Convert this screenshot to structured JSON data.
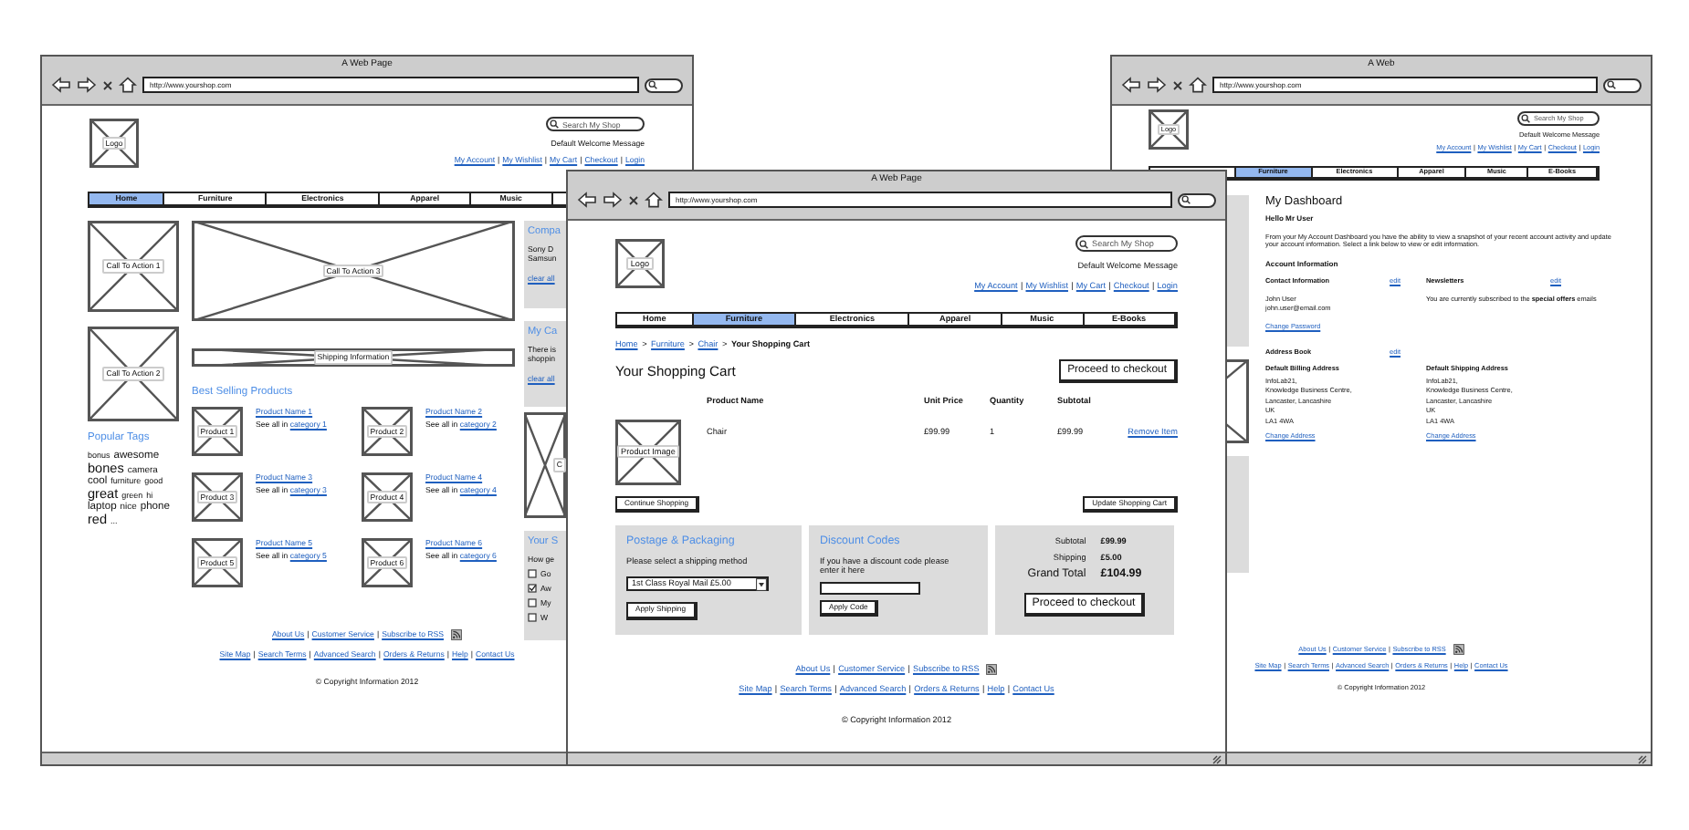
{
  "windows": [
    {
      "kind": "home",
      "title": "A Web Page",
      "url": "http://www.yourshop.com",
      "header": {
        "logo": "Logo",
        "search_placeholder": "Search My Shop",
        "welcome": "Default Welcome Message",
        "links": [
          "My Account",
          "My Wishlist",
          "My Cart",
          "Checkout",
          "Login"
        ],
        "separator": "|"
      },
      "nav": [
        {
          "label": "Home",
          "selected": true
        },
        {
          "label": "Furniture",
          "selected": false
        },
        {
          "label": "Electronics",
          "selected": false
        },
        {
          "label": "Apparel",
          "selected": false
        },
        {
          "label": "Music",
          "selected": false
        },
        {
          "selected": false
        }
      ],
      "ctas": [
        "Call To Action 1",
        "Call To Action 2"
      ],
      "banner": "Call To Action 3",
      "shipping_banner": "Shipping Information",
      "popular_tags": {
        "title": "Popular Tags",
        "tags": [
          {
            "label": "bonus",
            "kind": "tiny"
          },
          {
            "label": "awesome",
            "kind": "medium"
          },
          {
            "label": "bones",
            "kind": "large"
          },
          {
            "label": "camera",
            "kind": "small"
          },
          {
            "label": "cool",
            "kind": "medium"
          },
          {
            "label": "furniture",
            "kind": "tiny"
          },
          {
            "label": "good",
            "kind": "tiny"
          },
          {
            "label": "great",
            "kind": "large"
          },
          {
            "label": "green",
            "kind": "tiny"
          },
          {
            "label": "hi",
            "kind": "tiny"
          },
          {
            "label": "laptop",
            "kind": "medium"
          },
          {
            "label": "nice",
            "kind": "small"
          },
          {
            "label": "phone",
            "kind": "medium"
          },
          {
            "label": "red",
            "kind": "large"
          },
          {
            "label": "...",
            "kind": "tiny"
          }
        ]
      },
      "best_selling": {
        "title": "Best Selling Products",
        "products": [
          {
            "image": "Product 1",
            "name": "Product Name 1",
            "see_all": "See all in",
            "category": "category 1"
          },
          {
            "image": "Product 2",
            "name": "Product Name 2",
            "see_all": "See all in",
            "category": "category 2"
          },
          {
            "image": "Product 3",
            "name": "Product Name 3",
            "see_all": "See all in",
            "category": "category 3"
          },
          {
            "image": "Product 4",
            "name": "Product Name 4",
            "see_all": "See all in",
            "category": "category 4"
          },
          {
            "image": "Product 5",
            "name": "Product Name 5",
            "see_all": "See all in",
            "category": "category 5"
          },
          {
            "image": "Product 6",
            "name": "Product Name 6",
            "see_all": "See all in",
            "category": "category 6"
          }
        ]
      },
      "side": [
        {
          "kind": "panel",
          "title": "Compa",
          "lines": [
            "Sony D",
            "Samsun"
          ],
          "link": "clear all"
        },
        {
          "kind": "panel",
          "title": "My Ca",
          "lines": [
            "There is",
            "shoppin"
          ],
          "link": "clear all"
        },
        {
          "kind": "placeholder",
          "label": "C"
        },
        {
          "kind": "poll",
          "title": "Your S",
          "text": "How ge",
          "options": [
            {
              "label": "Go",
              "checked": false
            },
            {
              "label": "Aw",
              "checked": true
            },
            {
              "label": "My",
              "checked": false
            },
            {
              "label": "W",
              "checked": false
            }
          ]
        }
      ],
      "footer": {
        "rows": [
          {
            "links": [
              "About Us",
              "Customer Service",
              "Subscribe to RSS"
            ],
            "rss": true
          },
          {
            "links": [
              "Site Map",
              "Search Terms",
              "Advanced Search",
              "Orders & Returns",
              "Help",
              "Contact Us"
            ]
          }
        ],
        "separator": "|",
        "copyright": "© Copyright Information 2012"
      }
    },
    {
      "kind": "cart",
      "title": "A Web Page",
      "url": "http://www.yourshop.com",
      "header": {
        "logo": "Logo",
        "search_placeholder": "Search My Shop",
        "welcome": "Default Welcome Message",
        "links": [
          "My Account",
          "My Wishlist",
          "My Cart",
          "Checkout",
          "Login"
        ],
        "separator": "|"
      },
      "nav": [
        {
          "label": "Home",
          "selected": false
        },
        {
          "label": "Furniture",
          "selected": true
        },
        {
          "label": "Electronics",
          "selected": false
        },
        {
          "label": "Apparel",
          "selected": false
        },
        {
          "label": "Music",
          "selected": false
        },
        {
          "label": "E-Books",
          "selected": false
        }
      ],
      "breadcrumb": {
        "links": [
          "Home",
          "Furniture",
          "Chair"
        ],
        "separator": ">",
        "current": "Your Shopping Cart"
      },
      "heading": "Your Shopping Cart",
      "checkout_button": "Proceed to checkout",
      "table": {
        "columns": [
          "Product Name",
          "Unit Price",
          "Quantity",
          "Subtotal"
        ],
        "rows": [
          {
            "image": "Product Image",
            "name": "Chair",
            "unit_price": "£99.99",
            "quantity": "1",
            "subtotal": "£99.99",
            "remove": "Remove Item"
          }
        ]
      },
      "continue_button": "Continue Shopping",
      "update_button": "Update Shopping Cart",
      "postage": {
        "title": "Postage & Packaging",
        "text": "Please select a shipping method",
        "selected_option": "1st Class Royal Mail £5.00",
        "button": "Apply Shipping"
      },
      "discount": {
        "title": "Discount Codes",
        "text": "If you have a discount code please enter it here",
        "button": "Apply Code"
      },
      "totals": {
        "lines": [
          {
            "label": "Subtotal",
            "value": "£99.99",
            "kind": "normal"
          },
          {
            "label": "Shipping",
            "value": "£5.00",
            "kind": "normal"
          },
          {
            "label": "Grand Total",
            "value": "£104.99",
            "kind": "grand"
          }
        ],
        "button": "Proceed to checkout"
      },
      "footer": {
        "rows": [
          {
            "links": [
              "About Us",
              "Customer Service",
              "Subscribe to RSS"
            ],
            "rss": true
          },
          {
            "links": [
              "Site Map",
              "Search Terms",
              "Advanced Search",
              "Orders & Returns",
              "Help",
              "Contact Us"
            ]
          }
        ],
        "separator": "|",
        "copyright": "© Copyright Information 2012"
      }
    },
    {
      "kind": "dashboard",
      "title": "A Web",
      "url": "http://www.yourshop.com",
      "header": {
        "logo": "Logo",
        "search_placeholder": "Search My Shop",
        "welcome": "Default Welcome Message",
        "links": [
          "My Account",
          "My Wishlist",
          "My Cart",
          "Checkout",
          "Login"
        ],
        "separator": "|"
      },
      "nav": [
        {
          "selected": false
        },
        {
          "label": "Furniture",
          "selected": true
        },
        {
          "label": "Electronics",
          "selected": false
        },
        {
          "label": "Apparel",
          "selected": false
        },
        {
          "label": "Music",
          "selected": false
        },
        {
          "label": "E-Books",
          "selected": false
        }
      ],
      "heading": "My Dashboard",
      "greeting": "Hello Mr User",
      "intro": "From your My Account Dashboard you have the ability to view a snapshot of your recent account activity and update your account information. Select a link below to view or edit information.",
      "account_title": "Account Information",
      "sections": [
        {
          "title": "Contact Information",
          "edit": "edit",
          "lines": [
            "John User",
            "john.user@email.com"
          ],
          "link": "Change Password"
        },
        {
          "title": "Newsletters",
          "edit": "edit",
          "lines": [
            "You are currently subscribed to the **special offers** emails"
          ]
        }
      ],
      "address_book": {
        "title": "Address Book",
        "edit": "edit",
        "addresses": [
          {
            "title": "Default Billing Address",
            "lines": [
              "InfoLab21,",
              "Knowledge Business Centre,",
              "Lancaster, Lancashire",
              "UK",
              "LA1 4WA"
            ],
            "link": "Change Address"
          },
          {
            "title": "Default Shipping Address",
            "lines": [
              "InfoLab21,",
              "Knowledge Business Centre,",
              "Lancaster, Lancashire",
              "UK",
              "LA1 4WA"
            ],
            "link": "Change Address"
          }
        ]
      },
      "footer": {
        "rows": [
          {
            "links": [
              "About Us",
              "Customer Service",
              "Subscribe to RSS"
            ],
            "rss": true
          },
          {
            "links": [
              "Site Map",
              "Search Terms",
              "Advanced Search",
              "Orders & Returns",
              "Help",
              "Contact Us"
            ]
          }
        ],
        "separator": "|",
        "copyright": "© Copyright Information 2012"
      }
    }
  ]
}
